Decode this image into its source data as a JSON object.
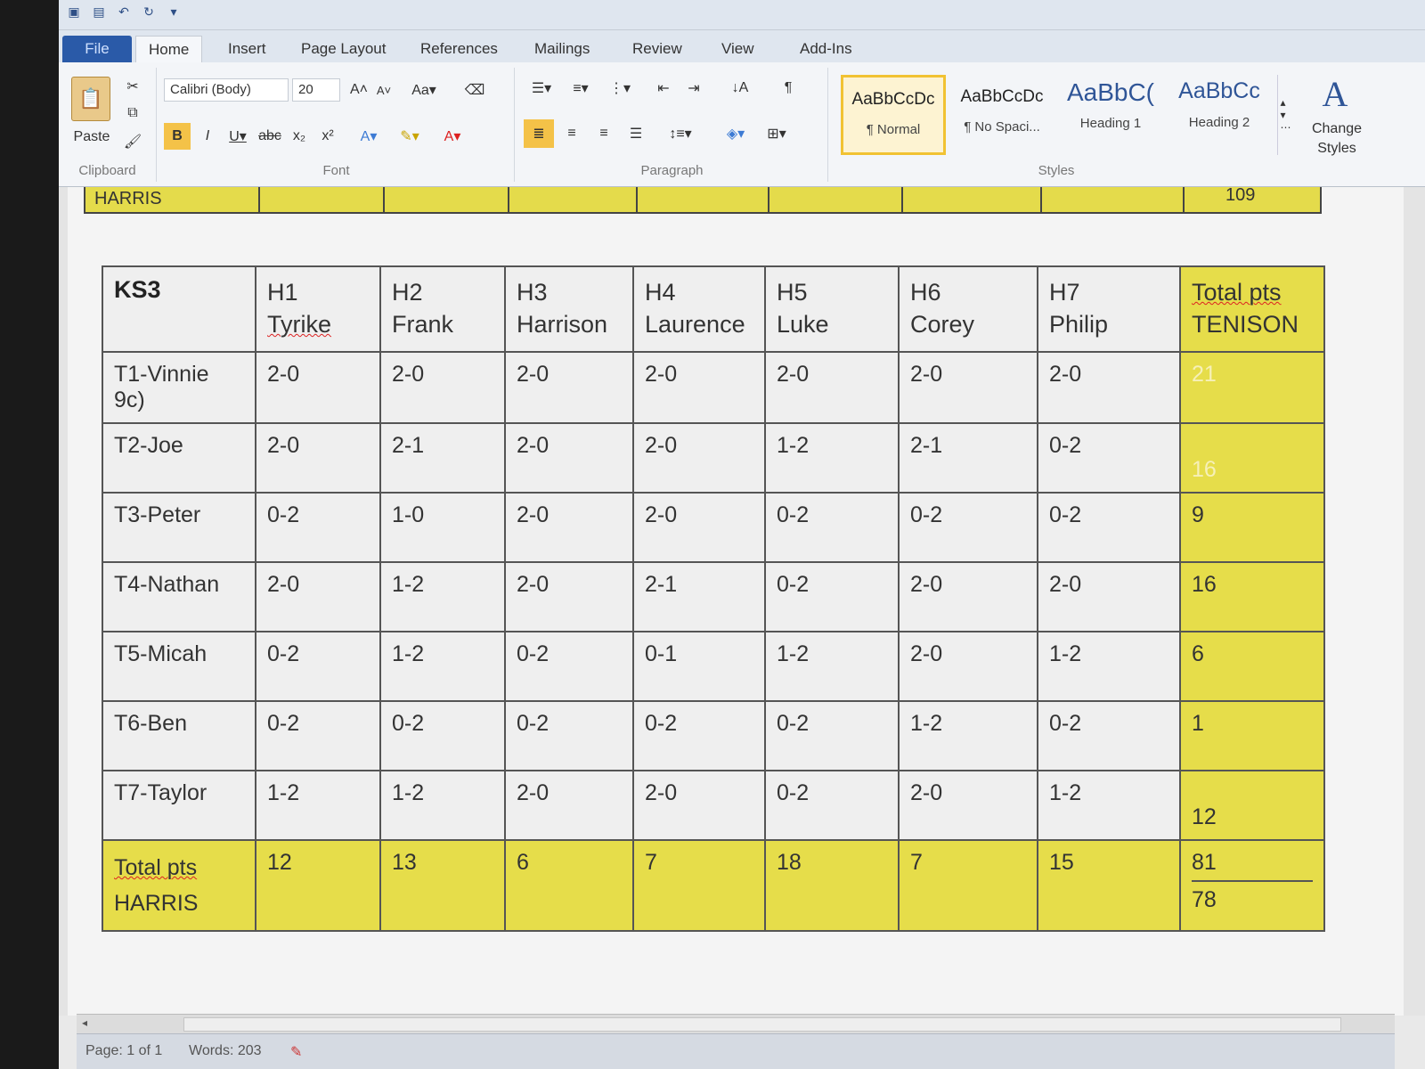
{
  "ribbon_tabs": [
    "File",
    "Home",
    "Insert",
    "Page Layout",
    "References",
    "Mailings",
    "Review",
    "View",
    "Add-Ins"
  ],
  "clipboard": {
    "paste_label": "Paste",
    "group_label": "Clipboard"
  },
  "font": {
    "name": "Calibri (Body)",
    "size": "20",
    "group_label": "Font"
  },
  "paragraph": {
    "group_label": "Paragraph"
  },
  "styles": {
    "group_label": "Styles",
    "items": [
      {
        "sample": "AaBbCcDc",
        "name": "¶ Normal"
      },
      {
        "sample": "AaBbCcDc",
        "name": "¶ No Spaci..."
      },
      {
        "sample": "AaBbC(",
        "name": "Heading 1"
      },
      {
        "sample": "AaBbCc",
        "name": "Heading 2"
      }
    ],
    "change_styles_line1": "Change",
    "change_styles_line2": "Styles"
  },
  "prev_table": {
    "left_text": "HARRIS",
    "right_text": "109"
  },
  "table": {
    "corner": "KS3",
    "headers": [
      [
        "H1",
        "Tyrike"
      ],
      [
        "H2",
        "Frank"
      ],
      [
        "H3",
        "Harrison"
      ],
      [
        "H4",
        "Laurence"
      ],
      [
        "H5",
        "Luke"
      ],
      [
        "H6",
        "Corey"
      ],
      [
        "H7",
        "Philip"
      ]
    ],
    "total_header": [
      "Total pts",
      "TENISON"
    ],
    "rows": [
      {
        "label": "T1-Vinnie 9c)",
        "scores": [
          "2-0",
          "2-0",
          "2-0",
          "2-0",
          "2-0",
          "2-0",
          "2-0"
        ],
        "total": "21"
      },
      {
        "label": "T2-Joe",
        "scores": [
          "2-0",
          "2-1",
          "2-0",
          "2-0",
          "1-2",
          "2-1",
          "0-2"
        ],
        "total": "16"
      },
      {
        "label": "T3-Peter",
        "scores": [
          "0-2",
          "1-0",
          "2-0",
          "2-0",
          "0-2",
          "0-2",
          "0-2"
        ],
        "total": "9"
      },
      {
        "label": "T4-Nathan",
        "scores": [
          "2-0",
          "1-2",
          "2-0",
          "2-1",
          "0-2",
          "2-0",
          "2-0"
        ],
        "total": "16"
      },
      {
        "label": "T5-Micah",
        "scores": [
          "0-2",
          "1-2",
          "0-2",
          "0-1",
          "1-2",
          "2-0",
          "1-2"
        ],
        "total": "6"
      },
      {
        "label": "T6-Ben",
        "scores": [
          "0-2",
          "0-2",
          "0-2",
          "0-2",
          "0-2",
          "1-2",
          "0-2"
        ],
        "total": "1"
      },
      {
        "label": "T7-Taylor",
        "scores": [
          "1-2",
          "1-2",
          "2-0",
          "2-0",
          "0-2",
          "2-0",
          "1-2"
        ],
        "total": "12"
      }
    ],
    "total_row": {
      "label_line1": "Total pts",
      "label_line2": "HARRIS",
      "values": [
        "12",
        "13",
        "6",
        "7",
        "18",
        "7",
        "15"
      ],
      "final_values": [
        "81",
        "78"
      ]
    }
  },
  "status": {
    "page": "Page: 1 of 1",
    "words": "Words: 203"
  }
}
